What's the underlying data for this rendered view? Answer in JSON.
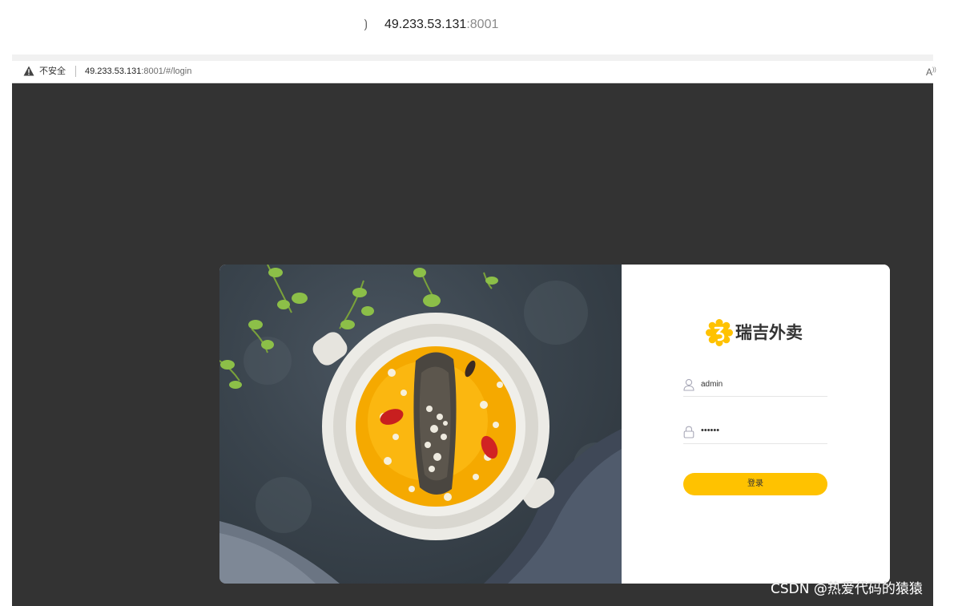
{
  "browser": {
    "tab_host": "49.233.53.131",
    "tab_port": ":8001",
    "security_label": "不安全",
    "url_host": "49.233.53.131",
    "url_rest": ":8001/#/login",
    "reader_icon": "A"
  },
  "login": {
    "brand_name": "瑞吉外卖",
    "brand_color": "#ffc200",
    "username_value": "admin",
    "password_value": "••••••",
    "login_button_label": "登录",
    "button_color": "#ffc200"
  },
  "page": {
    "background_color": "#333333"
  },
  "watermark": {
    "text": "CSDN @热爱代码的猿猿"
  }
}
